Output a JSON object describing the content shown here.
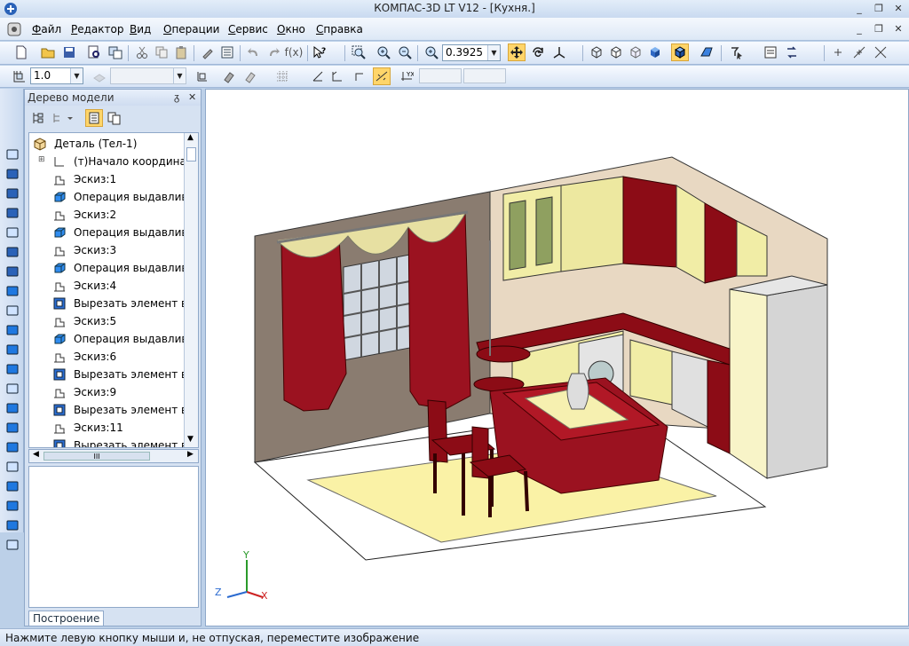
{
  "window": {
    "title": "КОМПАС-3D LT V12 - [Кухня.]"
  },
  "menu": [
    {
      "label": "Файл",
      "u": "Ф",
      "rest": "айл"
    },
    {
      "label": "Редактор",
      "u": "Р",
      "rest": "едактор"
    },
    {
      "label": "Вид",
      "u": "В",
      "rest": "ид"
    },
    {
      "label": "Операции",
      "u": "О",
      "rest": "перации"
    },
    {
      "label": "Сервис",
      "u": "С",
      "rest": "ервис"
    },
    {
      "label": "Окно",
      "u": "О",
      "rest": "кно"
    },
    {
      "label": "Справка",
      "u": "С",
      "rest": "правка"
    }
  ],
  "toolbar": {
    "zoom_value": "0.3925",
    "step_value": "1.0",
    "func_label": "f(x)"
  },
  "panel": {
    "title": "Дерево модели",
    "pin": "ᵹ",
    "close": "✕",
    "tab": "Построение",
    "scroll_h": "III"
  },
  "tree": [
    {
      "label": "Деталь (Тел-1)",
      "icon": "part"
    },
    {
      "label": "(т)Начало координат",
      "icon": "origin"
    },
    {
      "label": "Эскиз:1",
      "icon": "sketch"
    },
    {
      "label": "Операция выдавливания",
      "icon": "extrude"
    },
    {
      "label": "Эскиз:2",
      "icon": "sketch"
    },
    {
      "label": "Операция выдавливания",
      "icon": "extrude"
    },
    {
      "label": "Эскиз:3",
      "icon": "sketch"
    },
    {
      "label": "Операция выдавливания",
      "icon": "extrude"
    },
    {
      "label": "Эскиз:4",
      "icon": "sketch"
    },
    {
      "label": "Вырезать элемент выдавливания",
      "icon": "cut"
    },
    {
      "label": "Эскиз:5",
      "icon": "sketch"
    },
    {
      "label": "Операция выдавливания",
      "icon": "extrude"
    },
    {
      "label": "Эскиз:6",
      "icon": "sketch"
    },
    {
      "label": "Вырезать элемент выдавливания",
      "icon": "cut"
    },
    {
      "label": "Эскиз:9",
      "icon": "sketch"
    },
    {
      "label": "Вырезать элемент выдавливания",
      "icon": "cut"
    },
    {
      "label": "Эскиз:11",
      "icon": "sketch"
    },
    {
      "label": "Вырезать элемент выдавливания",
      "icon": "cut"
    }
  ],
  "axes": {
    "y": "Y",
    "z": "Z",
    "x": "X"
  },
  "status": {
    "hint": "Нажмите левую кнопку мыши и, не отпуская, переместите изображение"
  },
  "colors": {
    "wine": "#8c0c16",
    "cream": "#f4efb5",
    "accent": "#ffd56a"
  }
}
